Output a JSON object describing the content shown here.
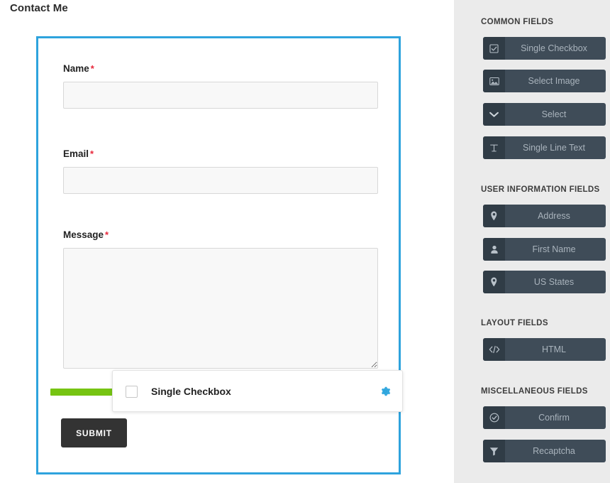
{
  "page": {
    "title": "Contact Me"
  },
  "form": {
    "accent_border_color": "#2ea3dd",
    "fields": [
      {
        "label": "Name",
        "required_marker": "*",
        "type": "text",
        "value": "",
        "placeholder": ""
      },
      {
        "label": "Email",
        "required_marker": "*",
        "type": "text",
        "value": "",
        "placeholder": ""
      },
      {
        "label": "Message",
        "required_marker": "*",
        "type": "textarea",
        "value": "",
        "placeholder": ""
      }
    ],
    "submit_label": "SUBMIT",
    "submit_color": "#333333",
    "drop_indicator_color": "#76c412"
  },
  "drag_overlay": {
    "label": "Single Checkbox",
    "checkbox_checked": false,
    "settings_icon": "gear-icon",
    "settings_icon_color": "#29a3dc"
  },
  "sidebar": {
    "background_color": "#ebebeb",
    "button_color": "#3f4c58",
    "button_icon_color": "#303c46",
    "sections": [
      {
        "title": "COMMON FIELDS",
        "items": [
          {
            "label": "Single Checkbox",
            "icon": "checkbox-checked-icon"
          },
          {
            "label": "Select Image",
            "icon": "image-icon"
          },
          {
            "label": "Select",
            "icon": "chevron-down-icon"
          },
          {
            "label": "Single Line Text",
            "icon": "text-cursor-icon"
          }
        ]
      },
      {
        "title": "USER INFORMATION FIELDS",
        "items": [
          {
            "label": "Address",
            "icon": "map-pin-icon"
          },
          {
            "label": "First Name",
            "icon": "user-icon"
          },
          {
            "label": "US States",
            "icon": "map-pin-icon"
          }
        ]
      },
      {
        "title": "LAYOUT FIELDS",
        "items": [
          {
            "label": "HTML",
            "icon": "code-icon"
          }
        ]
      },
      {
        "title": "MISCELLANEOUS FIELDS",
        "items": [
          {
            "label": "Confirm",
            "icon": "check-circle-icon"
          },
          {
            "label": "Recaptcha",
            "icon": "filter-icon"
          }
        ]
      }
    ]
  }
}
